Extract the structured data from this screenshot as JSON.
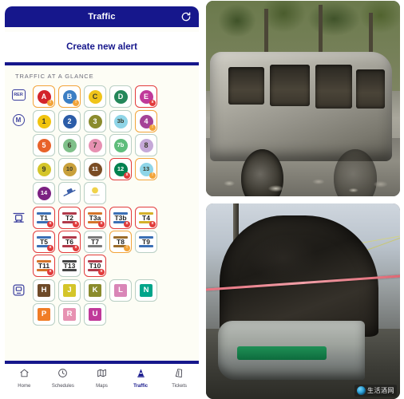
{
  "app": {
    "title": "Traffic",
    "refresh_icon": "refresh-icon",
    "create_alert_label": "Create new alert",
    "glance_title": "TRAFFIC AT A GLANCE"
  },
  "modes": [
    {
      "id": "rer",
      "icon": "rer-badge-icon",
      "icon_label": "RER",
      "rows": [
        [
          {
            "label": "A",
            "color": "#d3242b",
            "status": "warn",
            "badge": "!"
          },
          {
            "label": "B",
            "color": "#3b7ec4",
            "status": "warn",
            "badge": "!"
          },
          {
            "label": "C",
            "color": "#f0c419",
            "status": "ok",
            "badge": ""
          },
          {
            "label": "D",
            "color": "#24875a",
            "status": "ok",
            "badge": ""
          },
          {
            "label": "E",
            "color": "#c0399a",
            "status": "alert",
            "badge": "x"
          }
        ]
      ]
    },
    {
      "id": "metro",
      "icon": "metro-badge-icon",
      "icon_label": "M",
      "rows": [
        [
          {
            "label": "1",
            "color": "#f1c40f",
            "status": "ok",
            "badge": ""
          },
          {
            "label": "2",
            "color": "#2b5ca8",
            "status": "ok",
            "badge": ""
          },
          {
            "label": "3",
            "color": "#8a8b2c",
            "status": "ok",
            "badge": ""
          },
          {
            "label": "3b",
            "color": "#8fd5e8",
            "status": "ok",
            "badge": ""
          },
          {
            "label": "4",
            "color": "#a54397",
            "status": "warn",
            "badge": "!"
          }
        ],
        [
          {
            "label": "5",
            "color": "#e8632a",
            "status": "ok",
            "badge": ""
          },
          {
            "label": "6",
            "color": "#7fc08a",
            "status": "ok",
            "badge": ""
          },
          {
            "label": "7",
            "color": "#e791b2",
            "status": "ok",
            "badge": ""
          },
          {
            "label": "7b",
            "color": "#5fbd7c",
            "status": "ok",
            "badge": ""
          },
          {
            "label": "8",
            "color": "#c5a9d8",
            "status": "ok",
            "badge": ""
          }
        ],
        [
          {
            "label": "9",
            "color": "#d4c52a",
            "status": "ok",
            "badge": ""
          },
          {
            "label": "10",
            "color": "#c9a03c",
            "status": "ok",
            "badge": ""
          },
          {
            "label": "11",
            "color": "#7a4c24",
            "status": "ok",
            "badge": ""
          },
          {
            "label": "12",
            "color": "#00814f",
            "status": "alert",
            "badge": "x"
          },
          {
            "label": "13",
            "color": "#8fd5e8",
            "status": "warn",
            "badge": "!"
          }
        ],
        [
          {
            "label": "14",
            "color": "#7b2182",
            "status": "ok",
            "badge": ""
          },
          {
            "label": "funicular",
            "icon": "funicular-icon",
            "status": "ok",
            "badge": ""
          },
          {
            "label": "orlyval",
            "icon": "orlyval-icon",
            "status": "ok",
            "badge": ""
          }
        ]
      ]
    },
    {
      "id": "tram",
      "icon": "tram-badge-icon",
      "icon_label": "tram",
      "rows": [
        [
          {
            "label": "T1",
            "color": "#3b6fb5",
            "status": "alert",
            "badge": "x"
          },
          {
            "label": "T2",
            "color": "#b03a4a",
            "status": "alert",
            "badge": "x"
          },
          {
            "label": "T3a",
            "color": "#d4742a",
            "status": "alert",
            "badge": "x"
          },
          {
            "label": "T3b",
            "color": "#3b6fb5",
            "status": "alert",
            "badge": "x"
          },
          {
            "label": "T4",
            "color": "#d4b02a",
            "status": "alert",
            "badge": "x"
          }
        ],
        [
          {
            "label": "T5",
            "color": "#3b6fb5",
            "status": "alert",
            "badge": "x"
          },
          {
            "label": "T6",
            "color": "#b03a4a",
            "status": "alert",
            "badge": "x"
          },
          {
            "label": "T7",
            "color": "#7a7a7a",
            "status": "ok",
            "badge": ""
          },
          {
            "label": "T8",
            "color": "#9a6b2a",
            "status": "warn",
            "badge": "!"
          },
          {
            "label": "T9",
            "color": "#3b6fb5",
            "status": "ok",
            "badge": ""
          }
        ],
        [
          {
            "label": "T11",
            "color": "#d4742a",
            "status": "alert",
            "badge": "x"
          },
          {
            "label": "T13",
            "color": "#444444",
            "status": "ok",
            "badge": ""
          },
          {
            "label": "T10",
            "color": "#b03a4a",
            "status": "alert",
            "badge": "x"
          }
        ]
      ]
    },
    {
      "id": "transilien",
      "icon": "transilien-badge-icon",
      "icon_label": "train",
      "rows": [
        [
          {
            "label": "H",
            "color": "#6e4a28",
            "status": "ok",
            "badge": ""
          },
          {
            "label": "J",
            "color": "#d4c52a",
            "status": "ok",
            "badge": ""
          },
          {
            "label": "K",
            "color": "#8a8b2c",
            "status": "ok",
            "badge": ""
          },
          {
            "label": "L",
            "color": "#d985b8",
            "status": "ok",
            "badge": ""
          },
          {
            "label": "N",
            "color": "#00a58a",
            "status": "ok",
            "badge": ""
          }
        ],
        [
          {
            "label": "P",
            "color": "#f07d26",
            "status": "ok",
            "badge": ""
          },
          {
            "label": "R",
            "color": "#e791b2",
            "status": "ok",
            "badge": ""
          },
          {
            "label": "U",
            "color": "#c0399a",
            "status": "ok",
            "badge": ""
          }
        ]
      ]
    }
  ],
  "tabs": [
    {
      "label": "Home",
      "icon": "home-icon",
      "active": false
    },
    {
      "label": "Schedules",
      "icon": "clock-icon",
      "active": false
    },
    {
      "label": "Maps",
      "icon": "map-icon",
      "active": false
    },
    {
      "label": "Traffic",
      "icon": "cone-icon",
      "active": true
    },
    {
      "label": "Tickets",
      "icon": "ticket-icon",
      "active": false
    }
  ],
  "photos": [
    {
      "id": "burnt-car-photo",
      "caption": ""
    },
    {
      "id": "burnt-tram-photo",
      "caption": "",
      "watermark": "生活酒网"
    }
  ],
  "colors": {
    "brand_blue": "#16178c",
    "status_warn": "#f2a43a",
    "status_alert": "#e23b3b",
    "status_ok": "#b9cfc4"
  }
}
